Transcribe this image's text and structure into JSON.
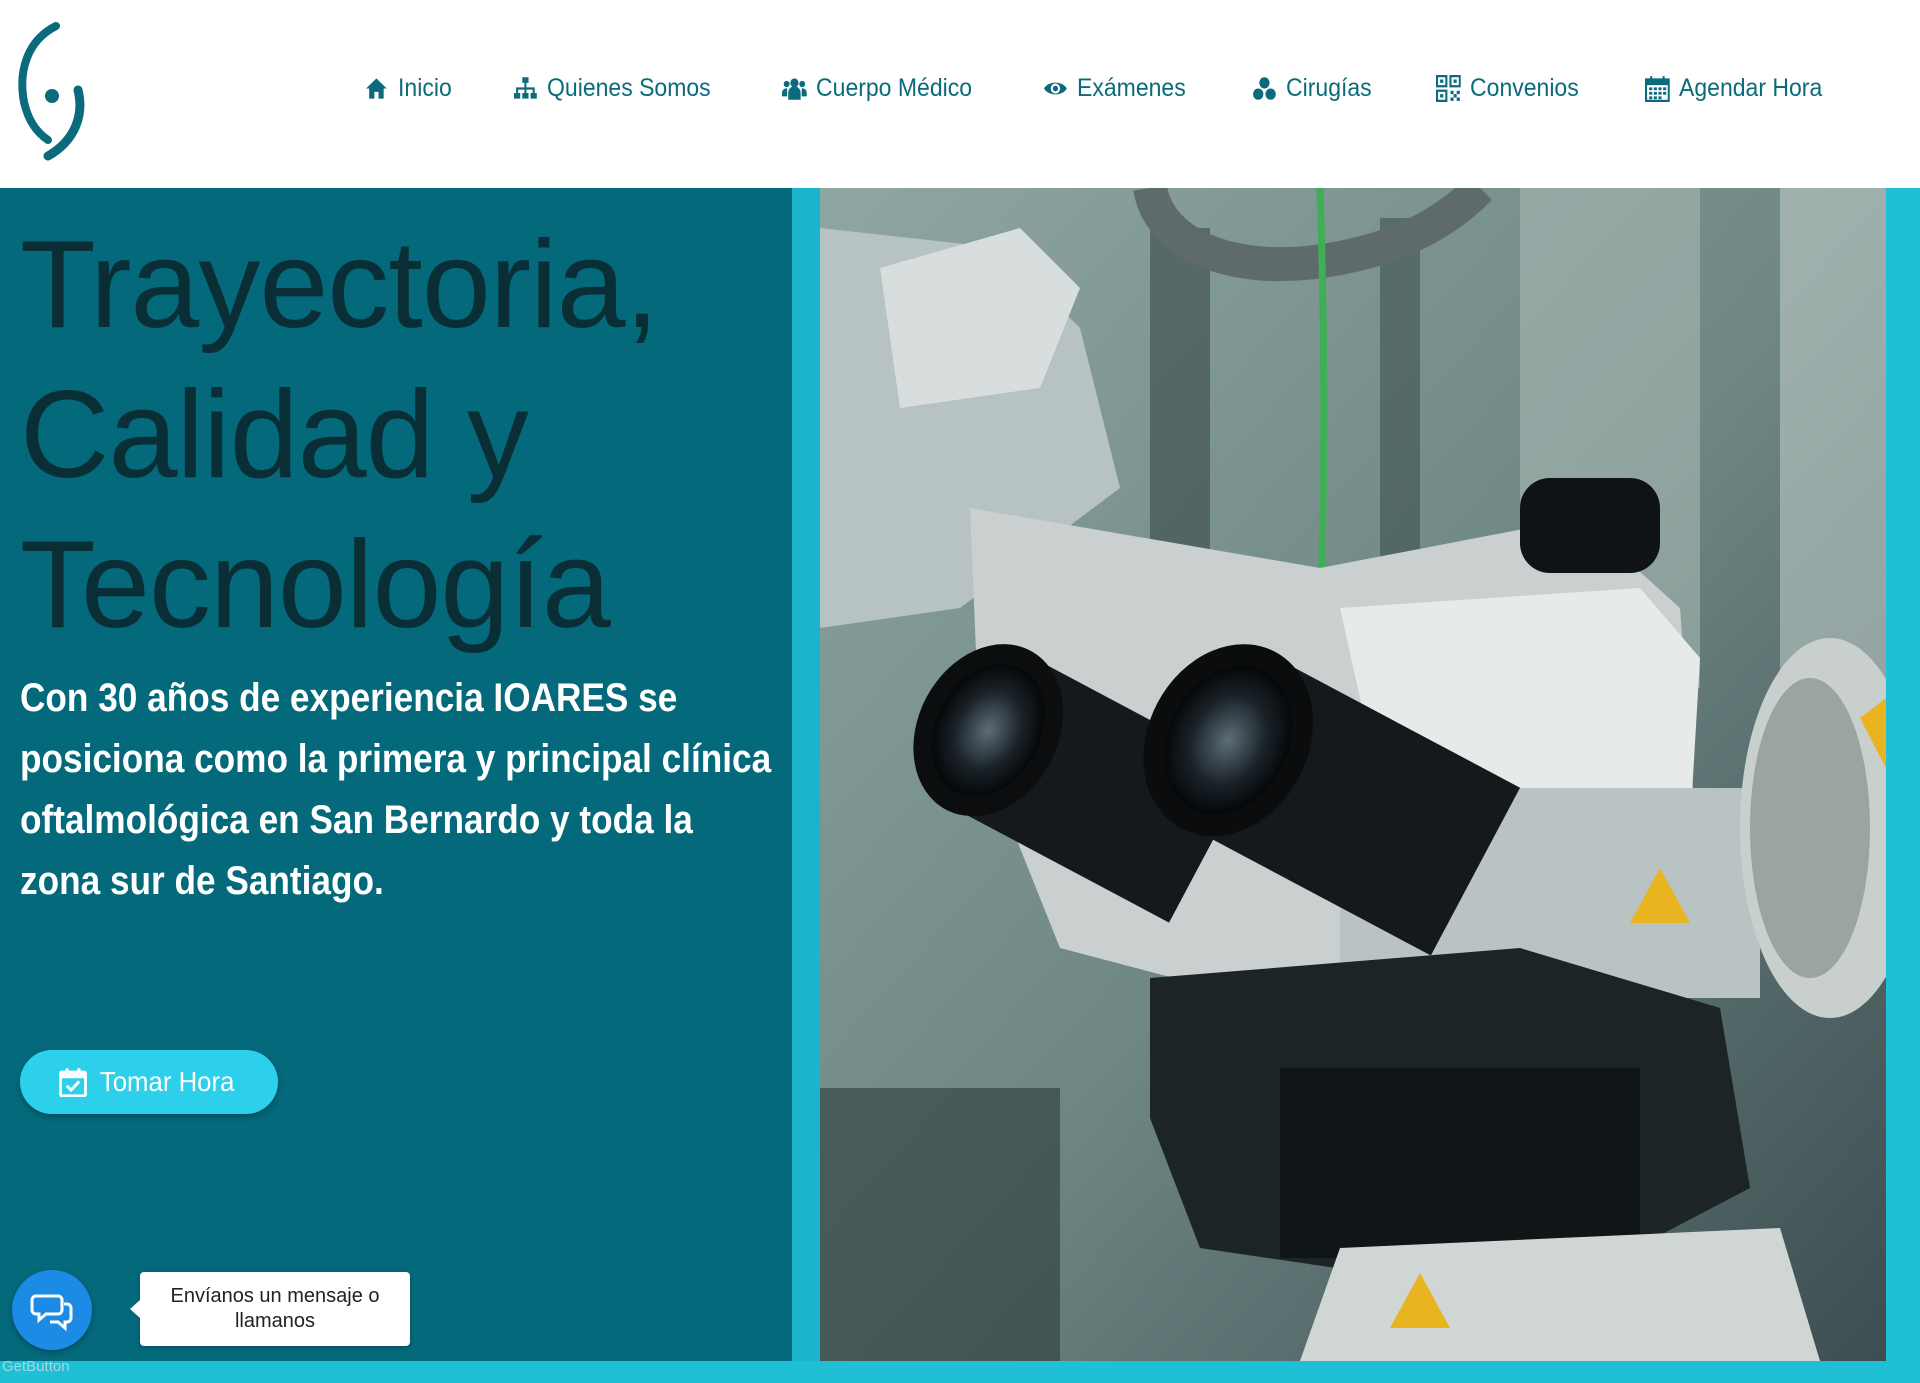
{
  "brand": {
    "logo_icon": "eye-logo-icon",
    "accent": "#0b6b7c"
  },
  "nav": {
    "items": [
      {
        "label": "Inicio",
        "icon": "home-icon"
      },
      {
        "label": "Quienes Somos",
        "icon": "sitemap-icon"
      },
      {
        "label": "Cuerpo Médico",
        "icon": "users-icon"
      },
      {
        "label": "Exámenes",
        "icon": "eye-icon"
      },
      {
        "label": "Cirugías",
        "icon": "cubes-icon"
      },
      {
        "label": "Convenios",
        "icon": "qrcode-icon"
      },
      {
        "label": "Agendar Hora",
        "icon": "calendar-icon"
      }
    ]
  },
  "hero": {
    "title_line1": "Trayectoria,",
    "title_line2": "Calidad y",
    "title_line3": "Tecnología",
    "lead": "Con 30 años de experiencia IOARES se posiciona como la primera y principal clínica oftalmológica en San Bernardo y toda la zona sur de Santiago.",
    "cta_label": "Tomar Hora",
    "cta_icon": "calendar-check-icon",
    "panel_color": "#04697b",
    "accent_strip_color": "#1fbfd6"
  },
  "chat": {
    "icon": "chat-bubbles-icon",
    "tooltip": "Envíanos un mensaje o llamanos",
    "badge": "GetButton",
    "color": "#1b8be6"
  }
}
